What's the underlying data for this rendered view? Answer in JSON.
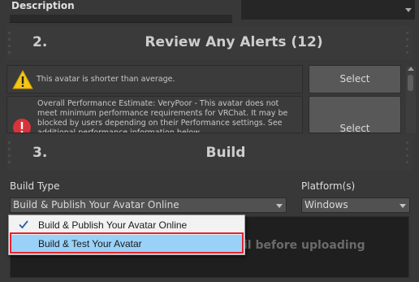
{
  "description": {
    "label": "Description"
  },
  "alerts_section": {
    "step": "2.",
    "title": "Review Any Alerts (12)",
    "alerts": [
      {
        "icon": "warning-icon",
        "text": "This avatar is shorter than average.",
        "button": "Select"
      },
      {
        "icon": "error-icon",
        "text": "Overall Performance Estimate: VeryPoor - This avatar does not meet minimum performance requirements for VRChat. It may be blocked by users depending on their Performance settings. See additional performance information below.",
        "button": "Select"
      }
    ]
  },
  "build_section": {
    "step": "3.",
    "title": "Build",
    "build_type_label": "Build Type",
    "build_type_value": "Build & Publish Your Avatar Online",
    "platform_label": "Platform(s)",
    "platform_value": "Windows",
    "panel_text": "il before uploading"
  },
  "dropdown_menu": {
    "options": [
      {
        "label": "Build & Publish Your Avatar Online",
        "checked": true
      },
      {
        "label": "Build & Test Your Avatar",
        "checked": false,
        "hovered": true
      }
    ]
  },
  "colors": {
    "background": "#383838",
    "menu_highlight": "#9ad1f8",
    "annotation_border": "#e5222b",
    "warning_yellow": "#f5c518",
    "error_red": "#d8333a"
  }
}
